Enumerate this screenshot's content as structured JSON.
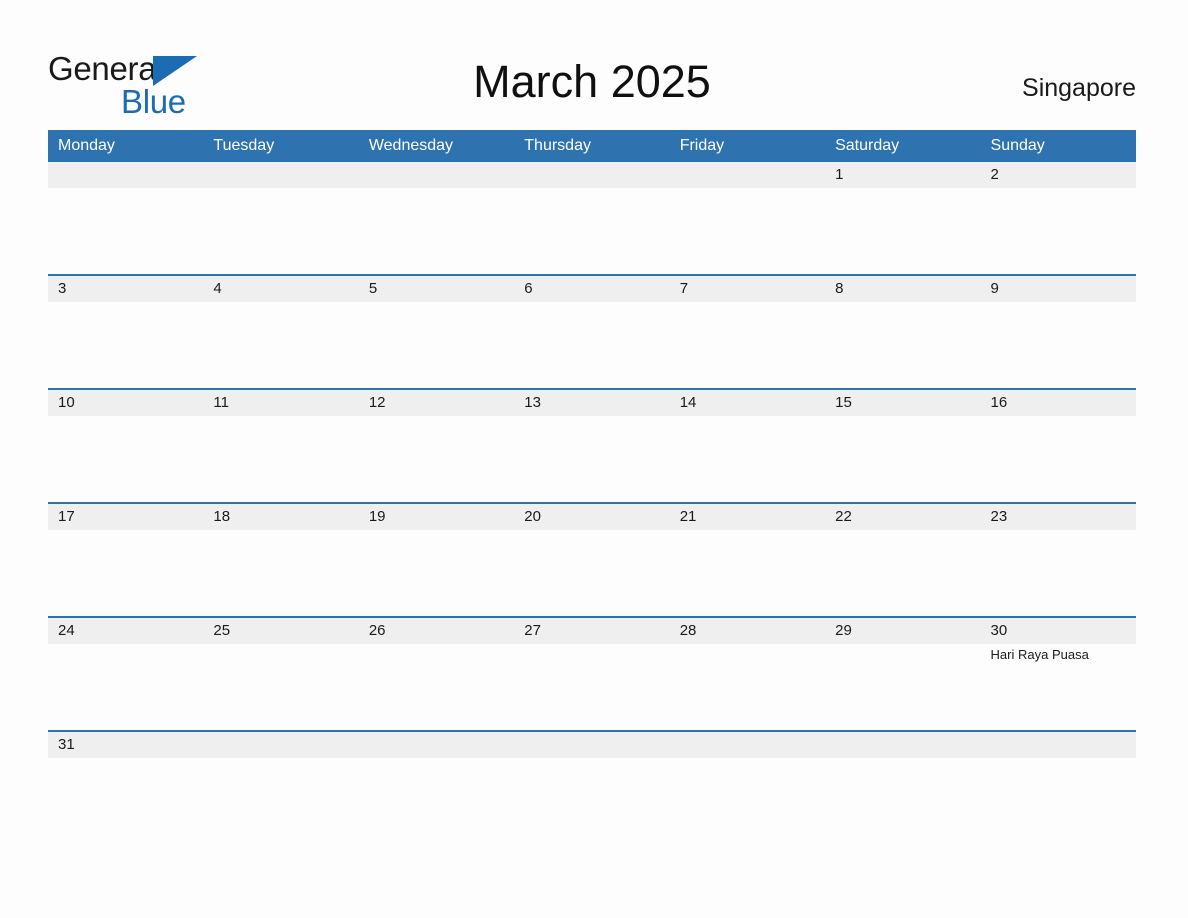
{
  "brand": {
    "name_part1": "General",
    "name_part2": "Blue",
    "triangle_icon": "blue-triangle-icon",
    "colors": {
      "text_dark": "#1a1a1a",
      "blue": "#1b6cb3"
    }
  },
  "header": {
    "title": "March 2025",
    "region": "Singapore"
  },
  "colors": {
    "header_blue": "#2e72b0",
    "band_gray": "#efefef",
    "page_background": "#fdfdfd",
    "rule_blue": "#2e72b0"
  },
  "weekdays": [
    "Monday",
    "Tuesday",
    "Wednesday",
    "Thursday",
    "Friday",
    "Saturday",
    "Sunday"
  ],
  "weeks": [
    {
      "rule": false,
      "days": [
        {
          "num": "",
          "event": "",
          "empty": true
        },
        {
          "num": "",
          "event": "",
          "empty": true
        },
        {
          "num": "",
          "event": "",
          "empty": true
        },
        {
          "num": "",
          "event": "",
          "empty": true
        },
        {
          "num": "",
          "event": "",
          "empty": true
        },
        {
          "num": "1",
          "event": "",
          "empty": false
        },
        {
          "num": "2",
          "event": "",
          "empty": false
        }
      ]
    },
    {
      "rule": true,
      "days": [
        {
          "num": "3",
          "event": "",
          "empty": false
        },
        {
          "num": "4",
          "event": "",
          "empty": false
        },
        {
          "num": "5",
          "event": "",
          "empty": false
        },
        {
          "num": "6",
          "event": "",
          "empty": false
        },
        {
          "num": "7",
          "event": "",
          "empty": false
        },
        {
          "num": "8",
          "event": "",
          "empty": false
        },
        {
          "num": "9",
          "event": "",
          "empty": false
        }
      ]
    },
    {
      "rule": true,
      "days": [
        {
          "num": "10",
          "event": "",
          "empty": false
        },
        {
          "num": "11",
          "event": "",
          "empty": false
        },
        {
          "num": "12",
          "event": "",
          "empty": false
        },
        {
          "num": "13",
          "event": "",
          "empty": false
        },
        {
          "num": "14",
          "event": "",
          "empty": false
        },
        {
          "num": "15",
          "event": "",
          "empty": false
        },
        {
          "num": "16",
          "event": "",
          "empty": false
        }
      ]
    },
    {
      "rule": true,
      "days": [
        {
          "num": "17",
          "event": "",
          "empty": false
        },
        {
          "num": "18",
          "event": "",
          "empty": false
        },
        {
          "num": "19",
          "event": "",
          "empty": false
        },
        {
          "num": "20",
          "event": "",
          "empty": false
        },
        {
          "num": "21",
          "event": "",
          "empty": false
        },
        {
          "num": "22",
          "event": "",
          "empty": false
        },
        {
          "num": "23",
          "event": "",
          "empty": false
        }
      ]
    },
    {
      "rule": true,
      "days": [
        {
          "num": "24",
          "event": "",
          "empty": false
        },
        {
          "num": "25",
          "event": "",
          "empty": false
        },
        {
          "num": "26",
          "event": "",
          "empty": false
        },
        {
          "num": "27",
          "event": "",
          "empty": false
        },
        {
          "num": "28",
          "event": "",
          "empty": false
        },
        {
          "num": "29",
          "event": "",
          "empty": false
        },
        {
          "num": "30",
          "event": "Hari Raya Puasa",
          "empty": false
        }
      ]
    },
    {
      "rule": true,
      "days": [
        {
          "num": "31",
          "event": "",
          "empty": false
        },
        {
          "num": "",
          "event": "",
          "empty": true
        },
        {
          "num": "",
          "event": "",
          "empty": true
        },
        {
          "num": "",
          "event": "",
          "empty": true
        },
        {
          "num": "",
          "event": "",
          "empty": true
        },
        {
          "num": "",
          "event": "",
          "empty": true
        },
        {
          "num": "",
          "event": "",
          "empty": true
        }
      ]
    }
  ]
}
